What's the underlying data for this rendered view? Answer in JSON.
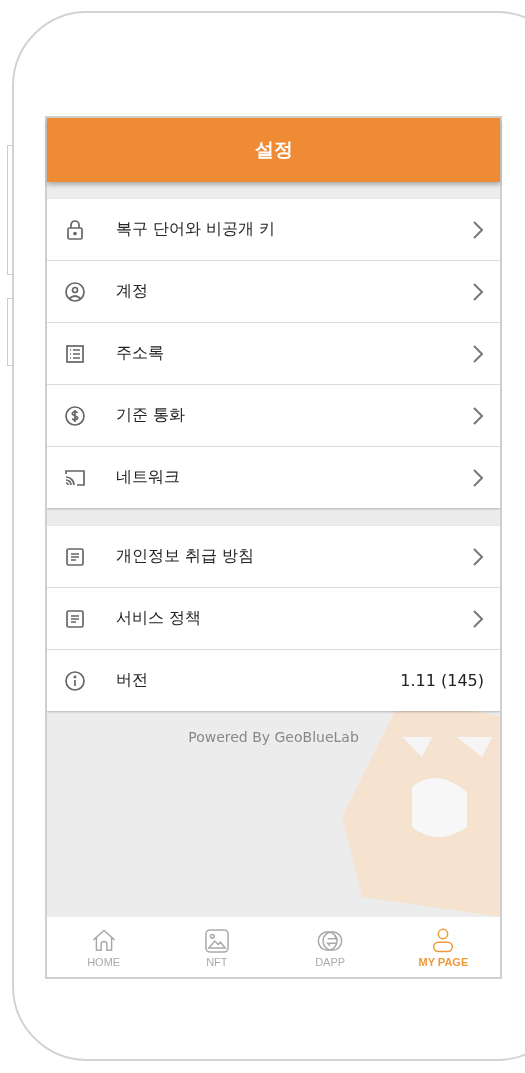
{
  "header": {
    "title": "설정"
  },
  "sections": [
    {
      "rows": [
        {
          "kind": "link",
          "label": "복구 단어와 비공개 키"
        },
        {
          "kind": "link",
          "label": "계정"
        },
        {
          "kind": "link",
          "label": "주소록"
        },
        {
          "kind": "link",
          "label": "기준 통화"
        },
        {
          "kind": "link",
          "label": "네트워크"
        }
      ]
    },
    {
      "rows": [
        {
          "kind": "link",
          "label": "개인정보 취급 방침"
        },
        {
          "kind": "link",
          "label": "서비스 정책"
        },
        {
          "kind": "info",
          "label": "버전",
          "value": "1.11 (145)"
        }
      ]
    }
  ],
  "footer": "Powered By GeoBlueLab",
  "tabs": [
    {
      "label": "HOME",
      "selected": false
    },
    {
      "label": "NFT",
      "selected": false
    },
    {
      "label": "DAPP",
      "selected": false
    },
    {
      "label": "MY PAGE",
      "selected": true
    }
  ]
}
